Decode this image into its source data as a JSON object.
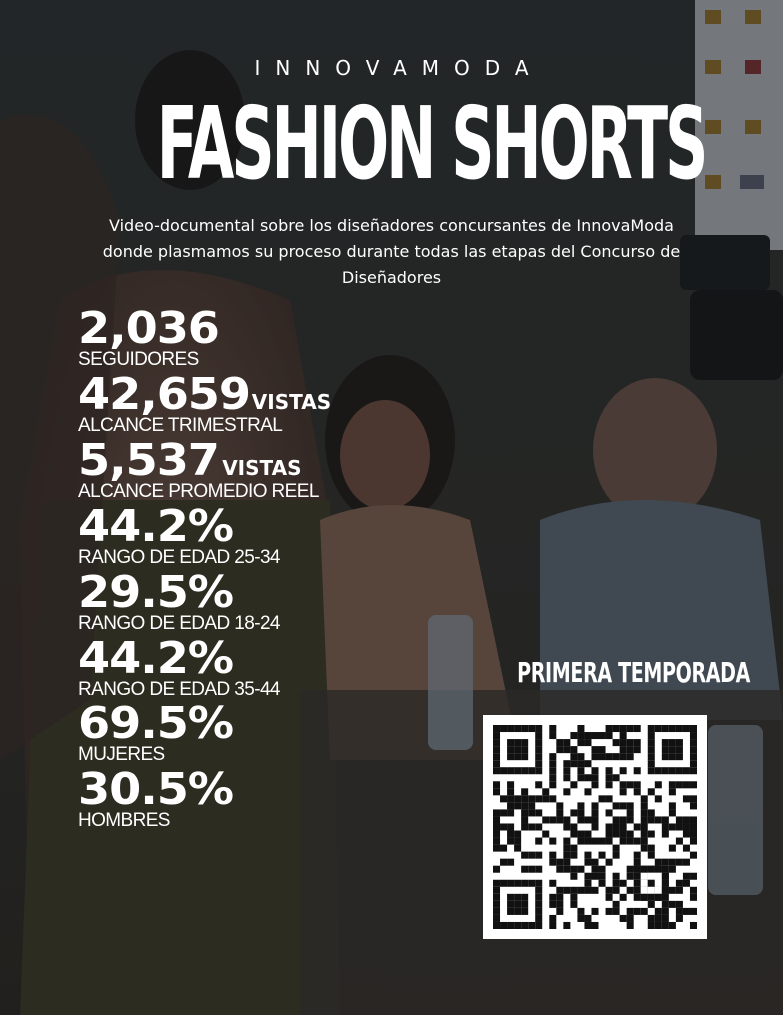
{
  "brand": "INNOVAMODA",
  "title": "FASHION SHORTS",
  "description": "Video-documental sobre los diseñadores concursantes de InnovaModa donde plasmamos su proceso durante todas las etapas del Concurso de Diseñadores",
  "stats": [
    {
      "value": "2,036",
      "unit": "",
      "label": "SEGUIDORES"
    },
    {
      "value": "42,659",
      "unit": "VISTAS",
      "label": "ALCANCE TRIMESTRAL"
    },
    {
      "value": "5,537",
      "unit": "VISTAS",
      "label": "ALCANCE PROMEDIO REEL"
    },
    {
      "value": "44.2%",
      "unit": "",
      "label": "RANGO DE EDAD 25-34"
    },
    {
      "value": "29.5%",
      "unit": "",
      "label": "RANGO DE EDAD 18-24"
    },
    {
      "value": "44.2%",
      "unit": "",
      "label": "RANGO DE EDAD 35-44"
    },
    {
      "value": "69.5%",
      "unit": "",
      "label": "MUJERES"
    },
    {
      "value": "30.5%",
      "unit": "",
      "label": "HOMBRES"
    }
  ],
  "season_label": "PRIMERA TEMPORADA",
  "colors": {
    "overlay": "#1f2426",
    "text": "#ffffff",
    "qr_dark": "#111111"
  }
}
